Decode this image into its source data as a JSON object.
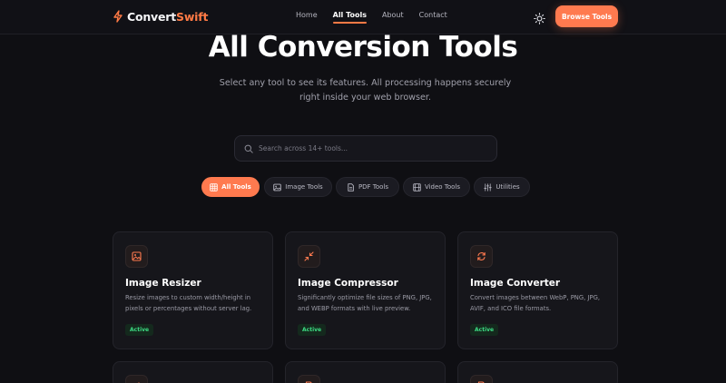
{
  "brand": {
    "part1": "Convert",
    "part2": "Swift"
  },
  "nav": {
    "links": [
      "Home",
      "All Tools",
      "About",
      "Contact"
    ],
    "active_index": 1,
    "browse_label": "Browse Tools"
  },
  "hero": {
    "title": "All Conversion Tools",
    "subtitle": "Select any tool to see its features. All processing happens securely right inside your web browser."
  },
  "search": {
    "placeholder": "Search across 14+ tools..."
  },
  "filters": [
    {
      "label": "All Tools",
      "icon": "grid-icon",
      "active": true
    },
    {
      "label": "Image Tools",
      "icon": "image-icon",
      "active": false
    },
    {
      "label": "PDF Tools",
      "icon": "document-icon",
      "active": false
    },
    {
      "label": "Video Tools",
      "icon": "film-icon",
      "active": false
    },
    {
      "label": "Utilities",
      "icon": "sliders-icon",
      "active": false
    }
  ],
  "tools": [
    {
      "title": "Image Resizer",
      "description": "Resize images to custom width/height in pixels or percentages without server lag.",
      "badge": "Active",
      "icon": "image-icon"
    },
    {
      "title": "Image Compressor",
      "description": "Significantly optimize file sizes of PNG, JPG, and WEBP formats with live preview.",
      "badge": "Active",
      "icon": "compress-icon"
    },
    {
      "title": "Image Converter",
      "description": "Convert images between WebP, PNG, JPG, AVIF, and ICO file formats.",
      "badge": "Active",
      "icon": "refresh-icon"
    }
  ],
  "colors": {
    "accent": "#ff7a4f",
    "background": "#0f0f13",
    "card": "#16161b",
    "badge_text": "#3ddc84"
  }
}
